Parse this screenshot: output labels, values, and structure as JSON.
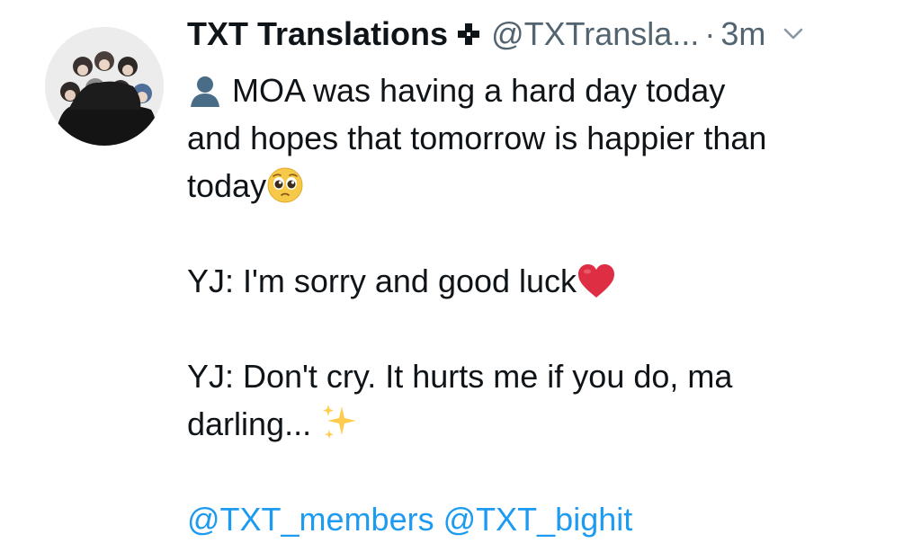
{
  "tweet": {
    "display_name": "TXT Translations",
    "badge_icon": "plus-cross-icon",
    "handle": "@TXTransla...",
    "separator": "·",
    "time": "3m",
    "menu_icon": "chevron-down-icon",
    "lines": {
      "line1": "MOA was having a hard day today",
      "line2": "and hopes that tomorrow is happier than",
      "line3": "today",
      "reply1": "YJ: I'm sorry and good luck",
      "reply2_a": "YJ: Don't cry. It hurts me if you do, ma",
      "reply2_b": "darling..."
    },
    "emojis": {
      "bust": "bust-in-silhouette-icon",
      "pleading": "pleading-face-icon",
      "heart": "red-heart-icon",
      "sparkles": "sparkles-icon"
    },
    "mentions": [
      "@TXT_members",
      "@TXT_bighit"
    ]
  },
  "colors": {
    "text": "#0f1419",
    "secondary": "#536471",
    "link": "#1d9bf0",
    "background": "#ffffff"
  }
}
